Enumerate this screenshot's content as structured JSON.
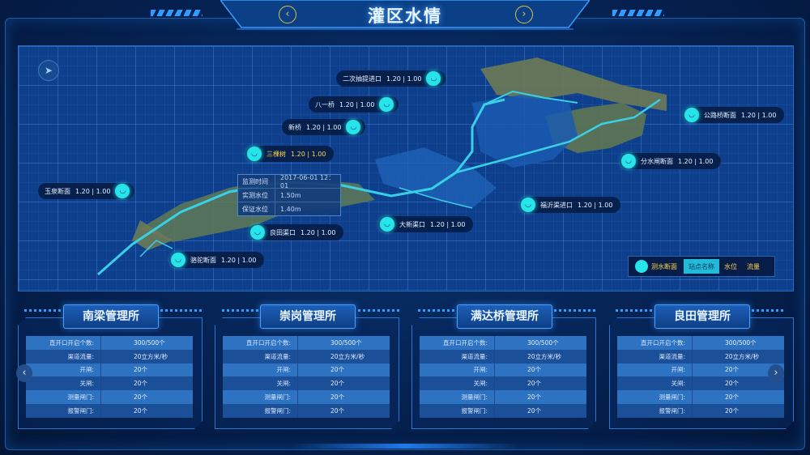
{
  "header": {
    "title": "灌区水情",
    "prev": "‹",
    "next": "›"
  },
  "map": {
    "stations": [
      {
        "id": "erci",
        "label": "二次抽提进口",
        "value": "1.20 | 1.00"
      },
      {
        "id": "bayi",
        "label": "八一桥",
        "value": "1.20 | 1.00"
      },
      {
        "id": "xinqiao",
        "label": "新桥",
        "value": "1.20 | 1.00"
      },
      {
        "id": "sankeshu",
        "label": "三棵树",
        "value": "1.20 | 1.00"
      },
      {
        "id": "yuquan",
        "label": "玉泉断面",
        "value": "1.20 | 1.00"
      },
      {
        "id": "gonglu",
        "label": "公路桥断面",
        "value": "1.20 | 1.00"
      },
      {
        "id": "fenshuizha",
        "label": "分水闸断面",
        "value": "1.20 | 1.00"
      },
      {
        "id": "fuqian",
        "label": "福沂渠进口",
        "value": "1.20 | 1.00"
      },
      {
        "id": "dashui",
        "label": "大新渠口",
        "value": "1.20 | 1.00"
      },
      {
        "id": "liangtian",
        "label": "良田渠口",
        "value": "1.20 | 1.00"
      },
      {
        "id": "luotuo",
        "label": "骆驼断面",
        "value": "1.20 | 1.00"
      }
    ],
    "popup": [
      {
        "k": "监测时间",
        "v": "2017-06-01  12：01"
      },
      {
        "k": "实测水位",
        "v": "1.50m"
      },
      {
        "k": "保证水位",
        "v": "1.40m"
      }
    ],
    "legend": {
      "name": "测水断面",
      "tabs": [
        "站点名称",
        "水位",
        "流量"
      ],
      "active": 0
    }
  },
  "panels": [
    {
      "title": "南梁管理所",
      "rows": [
        [
          "直开口开启个数:",
          "300/500个"
        ],
        [
          "渠道流量:",
          "20立方米/秒"
        ],
        [
          "开闸:",
          "20个"
        ],
        [
          "关闸:",
          "20个"
        ],
        [
          "测量闸门:",
          "20个"
        ],
        [
          "报警闸门:",
          "20个"
        ]
      ]
    },
    {
      "title": "崇岗管理所",
      "rows": [
        [
          "直开口开启个数:",
          "300/500个"
        ],
        [
          "渠道流量:",
          "20立方米/秒"
        ],
        [
          "开闸:",
          "20个"
        ],
        [
          "关闸:",
          "20个"
        ],
        [
          "测量闸门:",
          "20个"
        ],
        [
          "报警闸门:",
          "20个"
        ]
      ]
    },
    {
      "title": "满达桥管理所",
      "rows": [
        [
          "直开口开启个数:",
          "300/500个"
        ],
        [
          "渠道流量:",
          "20立方米/秒"
        ],
        [
          "开闸:",
          "20个"
        ],
        [
          "关闸:",
          "20个"
        ],
        [
          "测量闸门:",
          "20个"
        ],
        [
          "报警闸门:",
          "20个"
        ]
      ]
    },
    {
      "title": "良田管理所",
      "rows": [
        [
          "直开口开启个数:",
          "300/500个"
        ],
        [
          "渠道流量:",
          "20立方米/秒"
        ],
        [
          "开闸:",
          "20个"
        ],
        [
          "关闸:",
          "20个"
        ],
        [
          "测量闸门:",
          "20个"
        ],
        [
          "报警闸门:",
          "20个"
        ]
      ]
    }
  ],
  "nav": {
    "left": "‹",
    "right": "›"
  },
  "colors": {
    "accent": "#27e3ea",
    "highlight": "#ffd54a",
    "panel": "#2d73c2"
  }
}
